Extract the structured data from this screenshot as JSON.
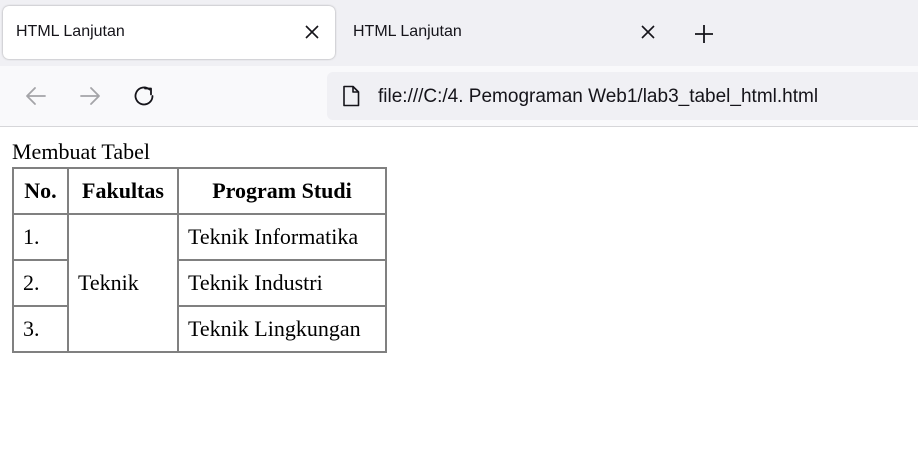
{
  "browser": {
    "tabs": [
      {
        "title": "HTML Lanjutan",
        "active": true,
        "close_icon": "close-icon"
      },
      {
        "title": "HTML Lanjutan",
        "active": false,
        "close_icon": "close-icon"
      }
    ],
    "new_tab_icon": "plus-icon",
    "nav": {
      "back_icon": "arrow-left-icon",
      "forward_icon": "arrow-right-icon",
      "reload_icon": "reload-icon"
    },
    "address": {
      "icon": "file-icon",
      "url": "file:///C:/4. Pemograman Web1/lab3_tabel_html.html"
    }
  },
  "page": {
    "caption": "Membuat Tabel",
    "table": {
      "headers": [
        "No.",
        "Fakultas",
        "Program Studi"
      ],
      "faculty": "Teknik",
      "rows": [
        {
          "no": "1.",
          "program": "Teknik Informatika"
        },
        {
          "no": "2.",
          "program": "Teknik Industri"
        },
        {
          "no": "3.",
          "program": "Teknik Lingkungan"
        }
      ]
    }
  },
  "colors": {
    "tabstrip_bg": "#f0f0f4",
    "navbar_bg": "#f9f9fb",
    "urlbar_bg": "#f0f0f4",
    "table_border": "#808080"
  }
}
